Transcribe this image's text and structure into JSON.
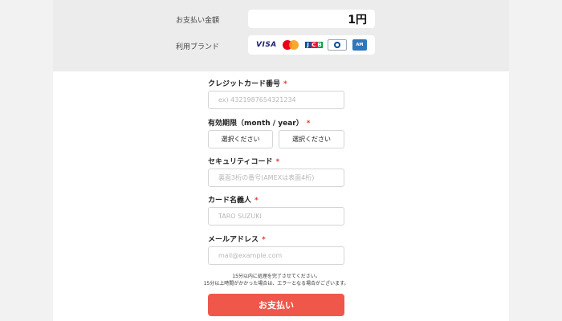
{
  "summary": {
    "amount_label": "お支払い金額",
    "amount_value": "1円",
    "brand_label": "利用ブランド",
    "brands": [
      {
        "name": "VISA",
        "icon": "visa-logo"
      },
      {
        "name": "Mastercard",
        "icon": "mastercard-logo"
      },
      {
        "name": "JCB",
        "icon": "jcb-logo"
      },
      {
        "name": "Diners Club",
        "icon": "diners-club-logo"
      },
      {
        "name": "American Express",
        "icon": "amex-logo"
      }
    ]
  },
  "form": {
    "required_mark": "*",
    "card_number": {
      "label": "クレジットカード番号",
      "placeholder": "ex) 4321987654321234"
    },
    "expiry": {
      "label": "有効期限（month / year）",
      "month_value": "選択ください",
      "year_value": "選択ください"
    },
    "security_code": {
      "label": "セキュリティコード",
      "placeholder": "裏面3桁の番号(AMEXは表面4桁)"
    },
    "card_holder": {
      "label": "カード名義人",
      "placeholder": "TARO SUZUKI"
    },
    "email": {
      "label": "メールアドレス",
      "placeholder": "mail@example.com"
    }
  },
  "notice": {
    "line1": "15分以内に処理を完了させてください。",
    "line2": "15分以上時間がかかった場合は、エラーとなる場合がございます。"
  },
  "pay_button_label": "お支払い",
  "colors": {
    "accent": "#f0574b",
    "required": "#e8382c",
    "summary_bg": "#ececec",
    "side_bg": "#f2f2f2"
  }
}
